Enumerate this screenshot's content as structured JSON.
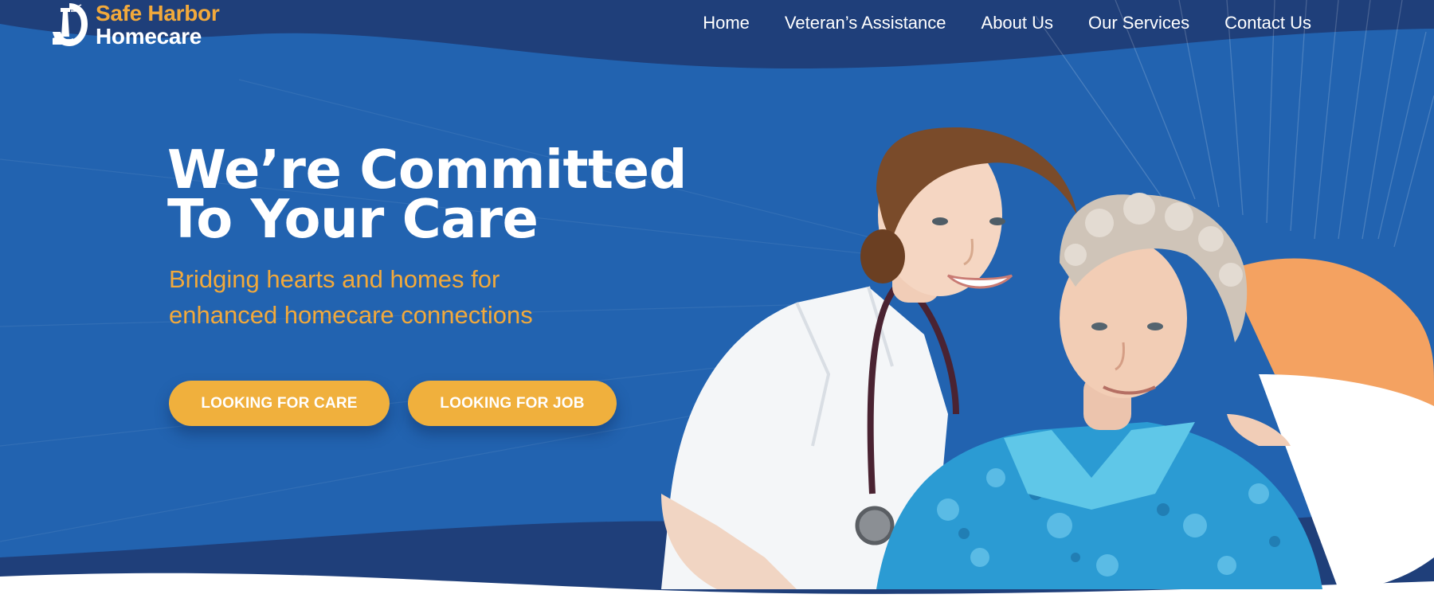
{
  "brand": {
    "name_line1": "Safe Harbor",
    "name_line2": "Homecare",
    "accent_color": "#f2a93b",
    "primary_color": "#2263b0",
    "header_color": "#1f3f7a",
    "logo_icon": "lighthouse-icon"
  },
  "nav": {
    "items": [
      {
        "label": "Home"
      },
      {
        "label": "Veteran’s Assistance"
      },
      {
        "label": "About Us"
      },
      {
        "label": "Our Services"
      },
      {
        "label": "Contact Us"
      }
    ]
  },
  "hero": {
    "headline_line1": "We’re Committed",
    "headline_line2": "To Your Care",
    "subhead_line1": "Bridging hearts and homes for",
    "subhead_line2": "enhanced homecare connections",
    "cta_care": "LOOKING FOR CARE",
    "cta_job": "LOOKING FOR JOB",
    "button_color": "#f0b03d",
    "image": "nurse-and-elderly-woman-photo"
  }
}
